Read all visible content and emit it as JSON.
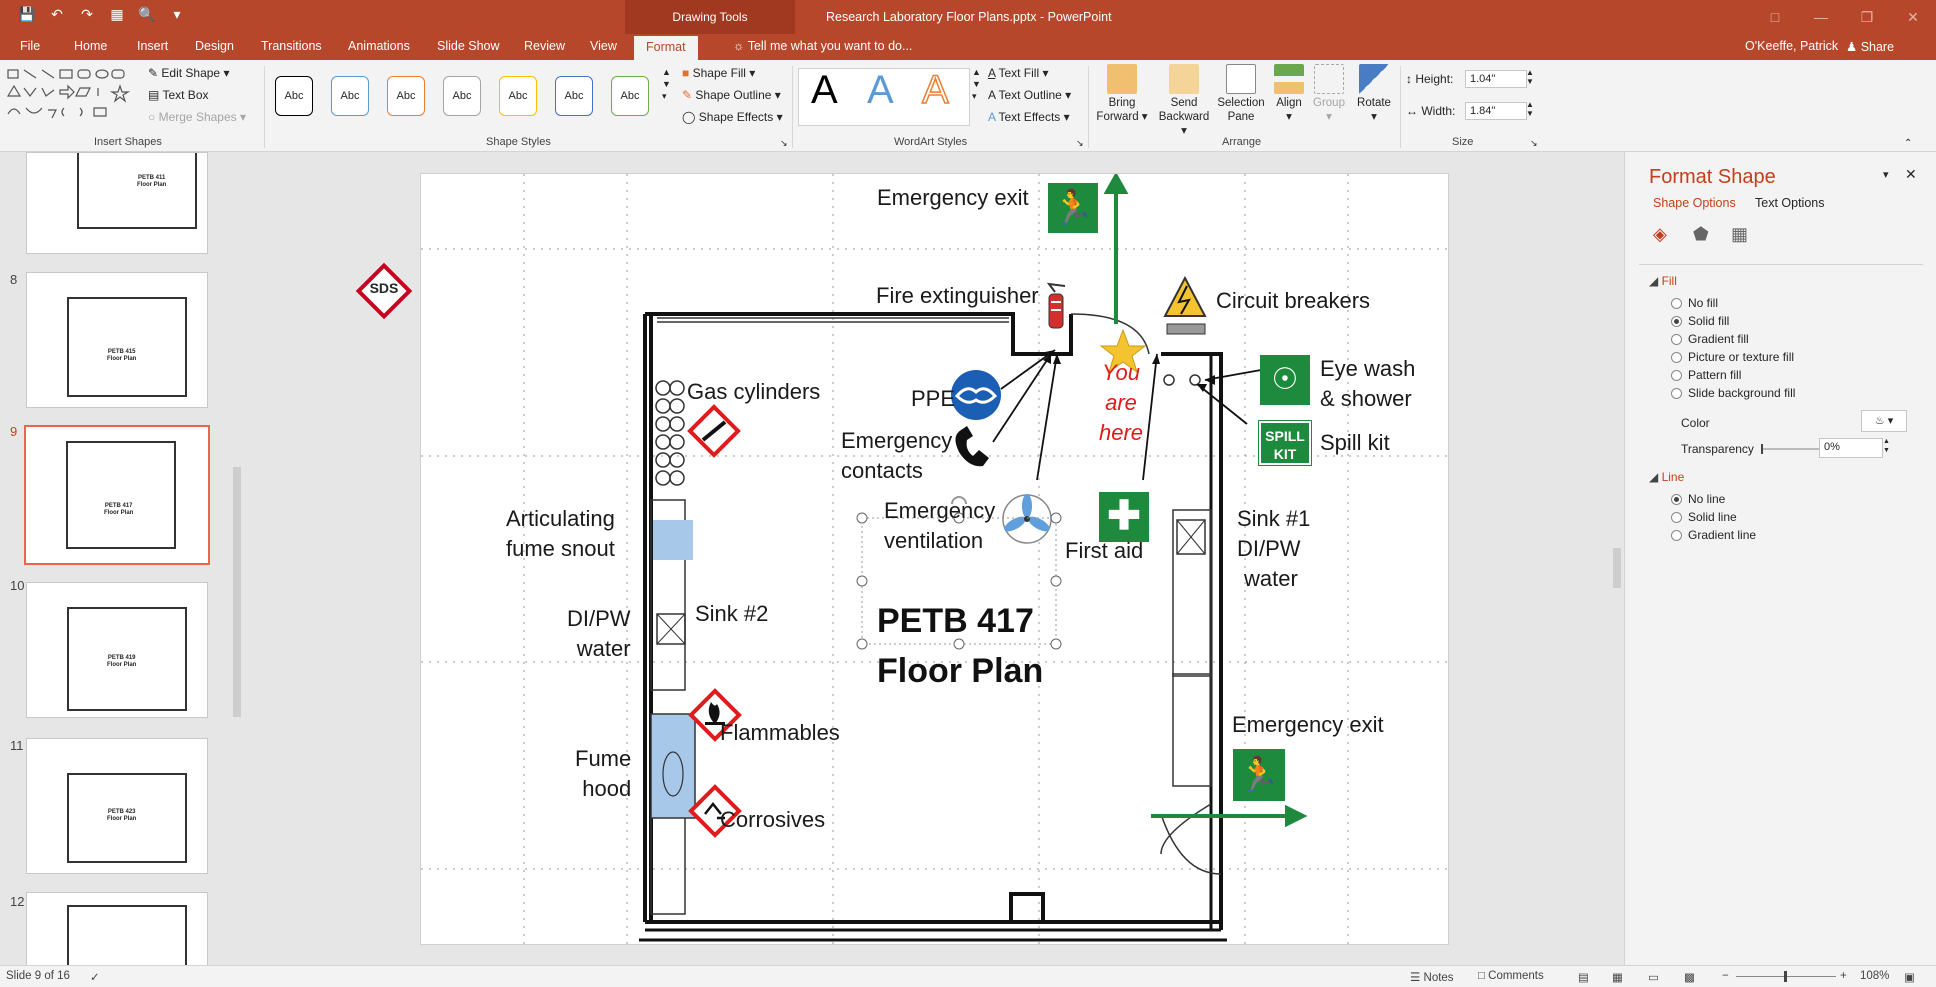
{
  "app": {
    "doc_title": "Research Laboratory Floor Plans.pptx - PowerPoint",
    "context_tab_group": "Drawing Tools"
  },
  "tabs": [
    "File",
    "Home",
    "Insert",
    "Design",
    "Transitions",
    "Animations",
    "Slide Show",
    "Review",
    "View",
    "Format"
  ],
  "active_tab": "Format",
  "tell_me": "Tell me what you want to do...",
  "user": "O'Keeffe, Patrick",
  "share_label": "Share",
  "ribbon": {
    "insert_shapes": {
      "label": "Insert Shapes",
      "edit_shape": "Edit Shape",
      "text_box": "Text Box",
      "merge_shapes": "Merge Shapes"
    },
    "shape_styles": {
      "label": "Shape Styles",
      "swatches": [
        {
          "text": "Abc",
          "color": "#000000"
        },
        {
          "text": "Abc",
          "color": "#5b9bd5"
        },
        {
          "text": "Abc",
          "color": "#ed7d31"
        },
        {
          "text": "Abc",
          "color": "#a5a5a5"
        },
        {
          "text": "Abc",
          "color": "#ffc000"
        },
        {
          "text": "Abc",
          "color": "#4472c4"
        },
        {
          "text": "Abc",
          "color": "#70ad47"
        }
      ],
      "shape_fill": "Shape Fill",
      "shape_outline": "Shape Outline",
      "shape_effects": "Shape Effects"
    },
    "wordart": {
      "label": "WordArt Styles",
      "samples": [
        "A",
        "A",
        "A"
      ],
      "text_fill": "Text Fill",
      "text_outline": "Text Outline",
      "text_effects": "Text Effects"
    },
    "arrange": {
      "label": "Arrange",
      "bring_forward": [
        "Bring",
        "Forward"
      ],
      "send_backward": [
        "Send",
        "Backward"
      ],
      "selection_pane": [
        "Selection",
        "Pane"
      ],
      "align": "Align",
      "group": "Group",
      "rotate": "Rotate"
    },
    "size": {
      "label": "Size",
      "height_label": "Height:",
      "height_value": "1.04\"",
      "width_label": "Width:",
      "width_value": "1.84\""
    }
  },
  "thumbnails": [
    {
      "num": "",
      "title": [
        "PETB 411",
        "Floor Plan"
      ],
      "selected": false
    },
    {
      "num": "8",
      "title": [
        "PETB 415",
        "Floor Plan"
      ],
      "selected": false
    },
    {
      "num": "9",
      "title": [
        "PETB 417",
        "Floor Plan"
      ],
      "selected": true
    },
    {
      "num": "10",
      "title": [
        "PETB 419",
        "Floor Plan"
      ],
      "selected": false
    },
    {
      "num": "11",
      "title": [
        "PETB 423",
        "Floor Plan"
      ],
      "selected": false
    },
    {
      "num": "12",
      "title": [
        "",
        ""
      ],
      "selected": false
    }
  ],
  "slide": {
    "sds": "SDS",
    "emergency_exit_top": "Emergency exit",
    "fire_extinguisher": "Fire extinguisher",
    "circuit_breakers": "Circuit breakers",
    "gas_cylinders": "Gas cylinders",
    "ppe": "PPE",
    "you_are_here": [
      "You",
      "are",
      "here"
    ],
    "eye_wash": [
      "Eye wash",
      "& shower"
    ],
    "emergency_contacts": [
      "Emergency",
      "contacts"
    ],
    "spill_kit": "Spill kit",
    "spill_kit_sign": [
      "SPILL",
      "KIT"
    ],
    "articulating": [
      "Articulating",
      "fume snout"
    ],
    "emergency_ventilation": [
      "Emergency",
      "ventilation"
    ],
    "first_aid": "First aid",
    "sink1": [
      "Sink #1",
      "DI/PW",
      "water"
    ],
    "dipw_left": [
      "DI/PW",
      "water"
    ],
    "sink2": "Sink #2",
    "floor_plan_title": [
      "PETB 417",
      "Floor Plan"
    ],
    "flammables": "Flammables",
    "fume_hood": [
      "Fume",
      "hood"
    ],
    "corrosives": "Corrosives",
    "emergency_exit_right": "Emergency exit"
  },
  "format_pane": {
    "title": "Format Shape",
    "shape_options": "Shape Options",
    "text_options": "Text Options",
    "fill_section": "Fill",
    "fill_options": [
      "No fill",
      "Solid fill",
      "Gradient fill",
      "Picture or texture fill",
      "Pattern fill",
      "Slide background fill"
    ],
    "fill_selected": 1,
    "color_label": "Color",
    "transparency_label": "Transparency",
    "transparency_value": "0%",
    "line_section": "Line",
    "line_options": [
      "No line",
      "Solid line",
      "Gradient line"
    ],
    "line_selected": 0
  },
  "status": {
    "slide_of": "Slide 9 of 16",
    "notes": "Notes",
    "comments": "Comments",
    "zoom": "108%"
  },
  "colors": {
    "accent": "#b7472a",
    "safety_green": "#1e8a3d",
    "hazard_red": "#e01b1b",
    "ppe_blue": "#1a5fb4"
  }
}
